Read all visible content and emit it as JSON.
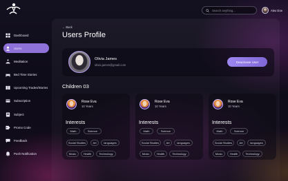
{
  "sidebar": {
    "items": [
      {
        "label": "Dashboard",
        "icon": "dashboard-icon",
        "active": false
      },
      {
        "label": "Users",
        "icon": "users-icon",
        "active": true
      },
      {
        "label": "Meditation",
        "icon": "meditation-icon",
        "active": false
      },
      {
        "label": "Bed Time Stories",
        "icon": "bed-icon",
        "active": false
      },
      {
        "label": "Upcoming Trades/Stories",
        "icon": "stories-icon",
        "active": false
      },
      {
        "label": "Subscription",
        "icon": "subscription-icon",
        "active": false
      },
      {
        "label": "Subject",
        "icon": "subject-icon",
        "active": false
      },
      {
        "label": "Promo Code",
        "icon": "promo-icon",
        "active": false
      },
      {
        "label": "Feedback",
        "icon": "feedback-icon",
        "active": false
      },
      {
        "label": "Push Notification",
        "icon": "notification-icon",
        "active": false
      }
    ]
  },
  "header": {
    "search_placeholder": "Search anything...",
    "user_name": "Alex Doe"
  },
  "main": {
    "back_label": "← Back",
    "title": "Users Profile",
    "profile": {
      "name": "Olivia James",
      "email": "olivia.james@gmail.com",
      "deactivate_label": "Deactivate User"
    },
    "children_title": "Children 03",
    "children": [
      {
        "name": "Rose Eva",
        "age": "10 Years",
        "interests_title": "Interests",
        "interests": [
          "Math",
          "Science",
          "Social Studies",
          "Art",
          "languages",
          "Music",
          "Health",
          "Technology"
        ]
      },
      {
        "name": "Rose Eva",
        "age": "10 Years",
        "interests_title": "Interests",
        "interests": [
          "Math",
          "Science",
          "Social Studies",
          "Art",
          "languages",
          "Music",
          "Health",
          "Technology"
        ]
      },
      {
        "name": "Rose Eva",
        "age": "10 Years",
        "interests_title": "Interests",
        "interests": [
          "Math",
          "Science",
          "Social Studies",
          "Art",
          "languages",
          "Music",
          "Health",
          "Technology"
        ]
      }
    ]
  },
  "colors": {
    "accent": "#8f72d8",
    "button": "#8b74e6",
    "background": "#0e0b18"
  }
}
